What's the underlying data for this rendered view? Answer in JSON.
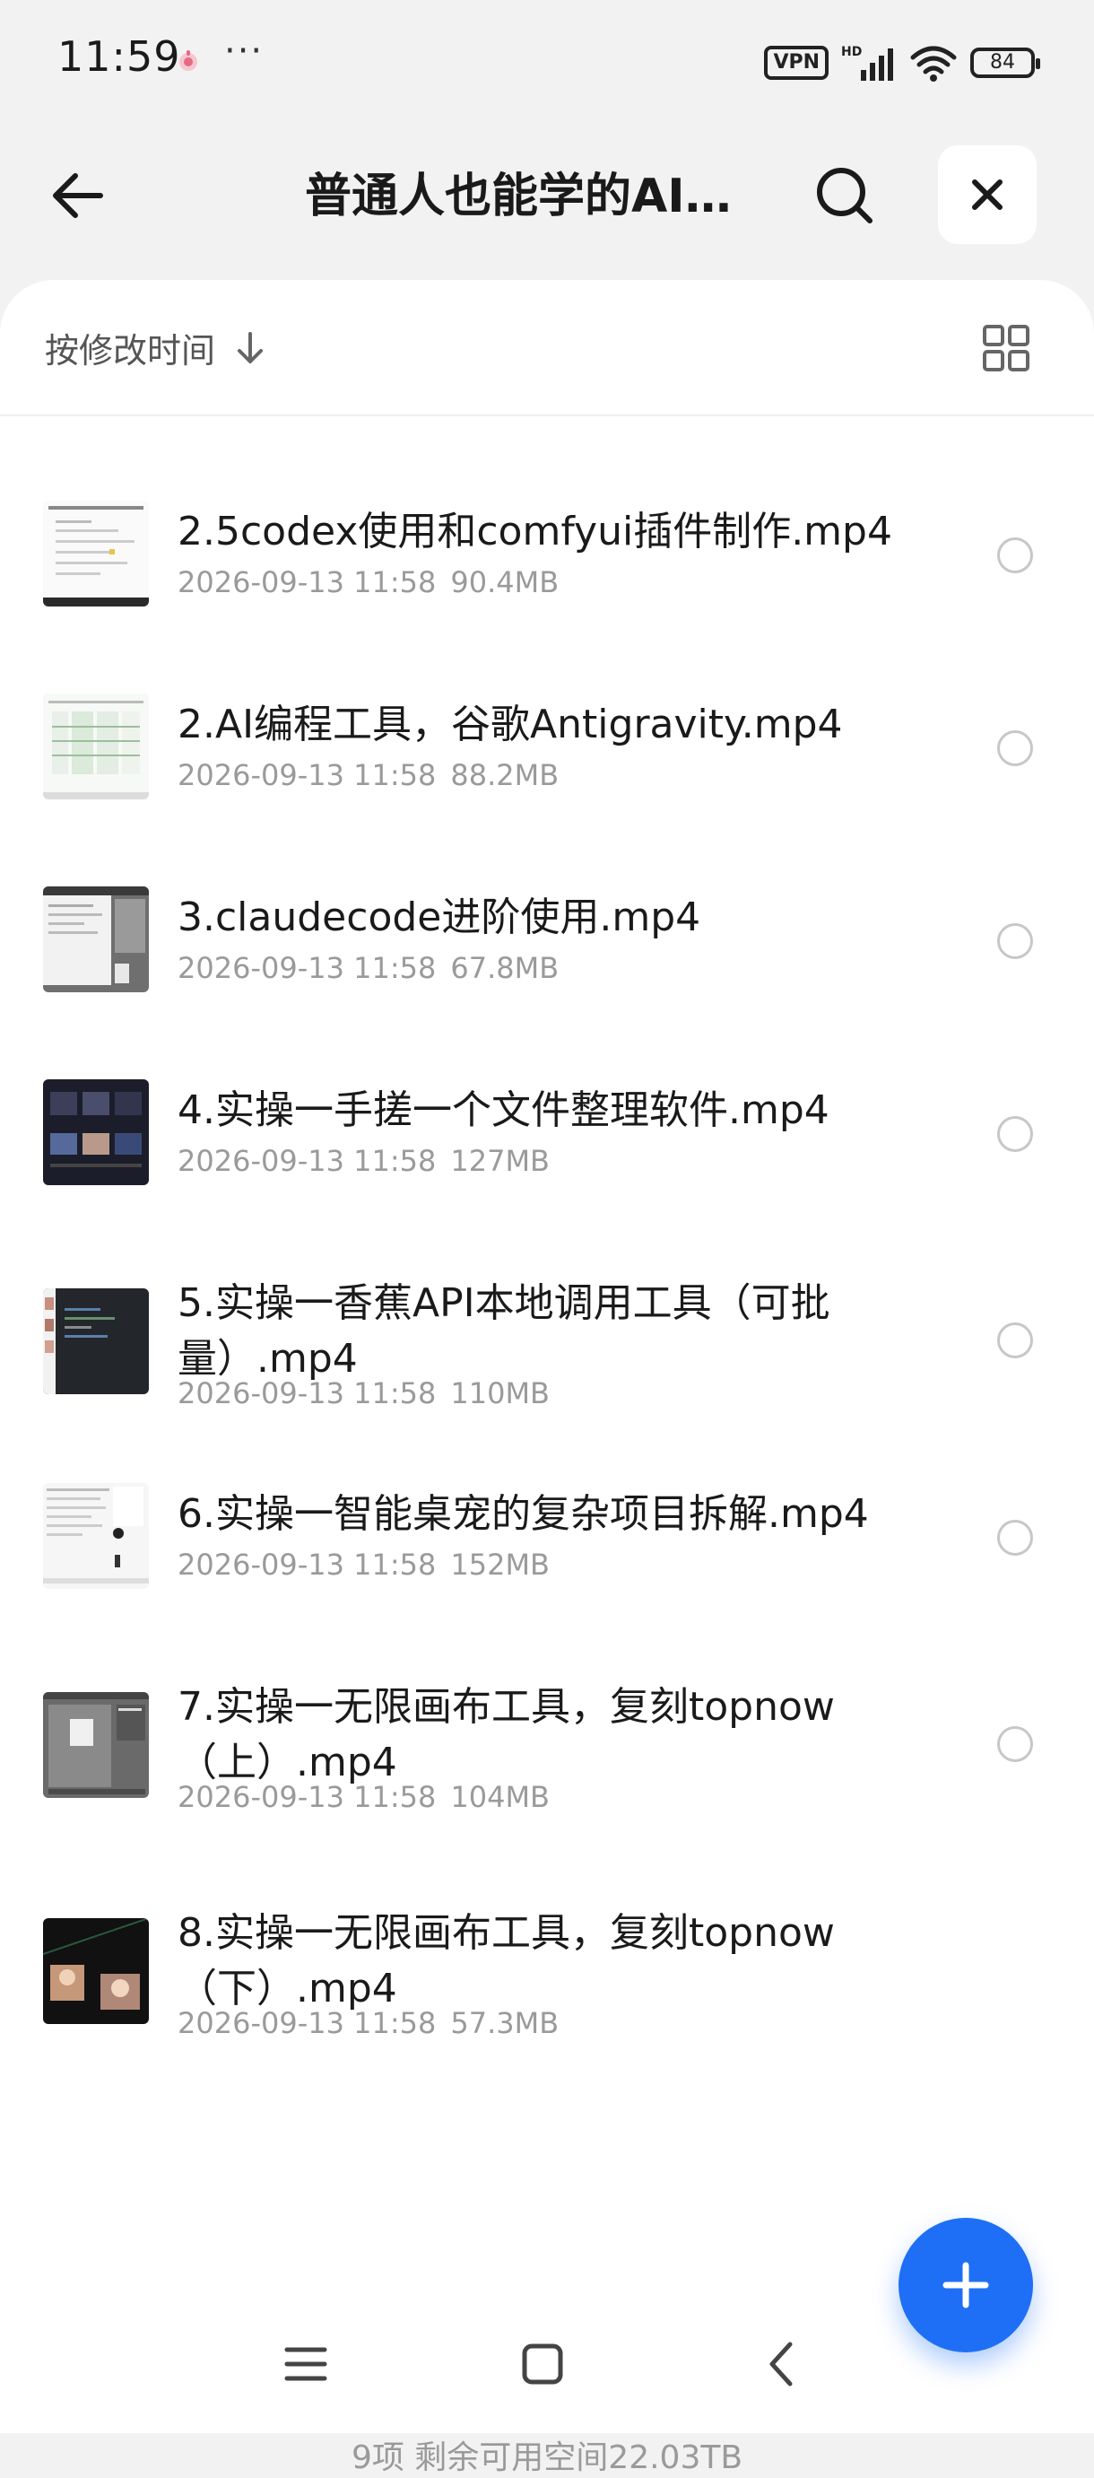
{
  "status_bar": {
    "time": "11:59",
    "more_indicator": "···",
    "vpn_label": "VPN",
    "battery_level": "84",
    "icons": [
      "app-notification-icon",
      "vpn-icon",
      "hd-signal-icon",
      "wifi-icon",
      "battery-icon"
    ]
  },
  "header": {
    "title": "普通人也能学的AI编程",
    "icons": [
      "back-arrow-icon",
      "search-icon",
      "close-icon"
    ]
  },
  "sort": {
    "label": "按修改时间",
    "direction_icon": "arrow-down-icon",
    "view_toggle_icon": "grid-view-icon"
  },
  "files": [
    {
      "name": "2.5codex使用和comfyui插件制作.mp4",
      "date": "2026-09-13 11:58",
      "size": "90.4MB",
      "thumb": "light"
    },
    {
      "name": "2.AI编程工具，谷歌Antigravity.mp4",
      "date": "2026-09-13 11:58",
      "size": "88.2MB",
      "thumb": "light-table"
    },
    {
      "name": "3.claudecode进阶使用.mp4",
      "date": "2026-09-13 11:58",
      "size": "67.8MB",
      "thumb": "gray"
    },
    {
      "name": "4.实操一手搓一个文件整理软件.mp4",
      "date": "2026-09-13 11:58",
      "size": "127MB",
      "thumb": "dark-gallery"
    },
    {
      "name": "5.实操一香蕉API本地调用工具（可批量）.mp4",
      "date": "2026-09-13 11:58",
      "size": "110MB",
      "thumb": "dark-code"
    },
    {
      "name": "6.实操一智能桌宠的复杂项目拆解.mp4",
      "date": "2026-09-13 11:58",
      "size": "152MB",
      "thumb": "light-doc"
    },
    {
      "name": "7.实操一无限画布工具，复刻topnow（上）.mp4",
      "date": "2026-09-13 11:58",
      "size": "104MB",
      "thumb": "gray-canvas"
    },
    {
      "name": "8.实操一无限画布工具，复刻topnow（下）.mp4",
      "date": "2026-09-13 11:58",
      "size": "57.3MB",
      "thumb": "dark-photos"
    }
  ],
  "summary": "9项 剩余可用空间22.03TB",
  "colors": {
    "accent": "#1e6ff5",
    "background": "#f2f2f2",
    "panel": "#ffffff",
    "meta_text": "#9a9a9a"
  },
  "fab_icon": "plus-icon",
  "nav_bar": {
    "icons": [
      "menu-icon",
      "home-icon",
      "back-icon"
    ]
  }
}
